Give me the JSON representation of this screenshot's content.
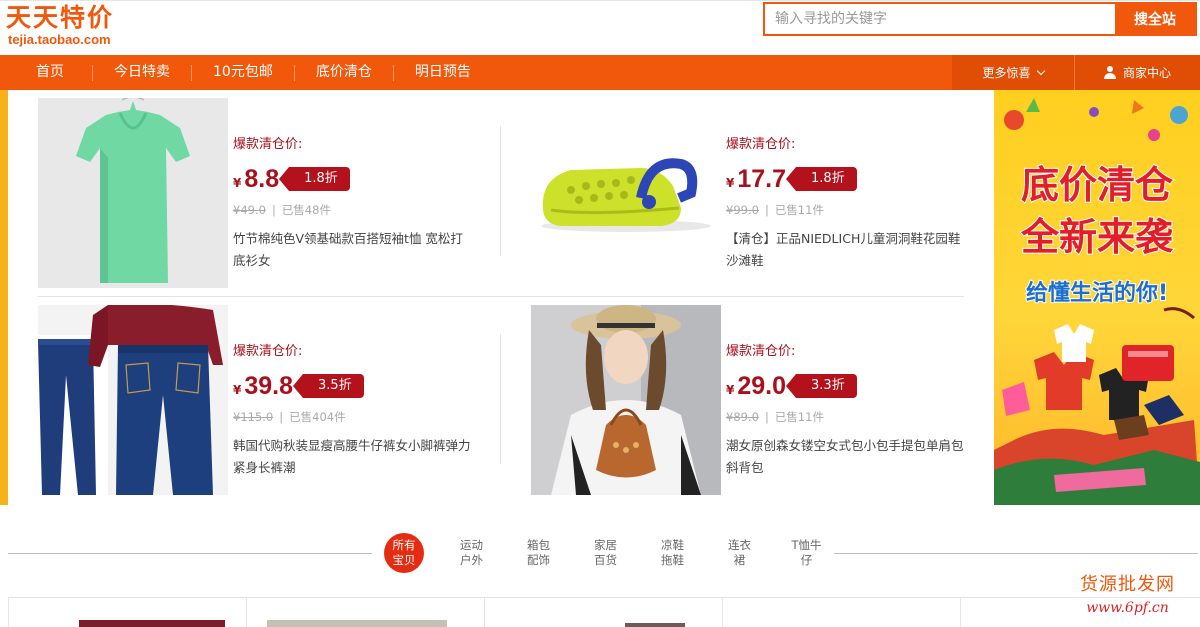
{
  "header": {
    "logo_title": "天天特价",
    "logo_url": "tejia.taobao.com",
    "search_placeholder": "输入寻找的关键字",
    "search_button": "搜全站"
  },
  "nav": {
    "items": [
      "首页",
      "今日特卖",
      "10元包邮",
      "底价清仓",
      "明日预告"
    ],
    "more": "更多惊喜",
    "merchant": "商家中心"
  },
  "products": [
    {
      "label": "爆款清仓价:",
      "currency": "¥",
      "price": "8.8",
      "discount": "1.8折",
      "original": "¥49.0",
      "sold": "已售48件",
      "title": "竹节棉纯色V领基础款百搭短袖t恤 宽松打底衫女"
    },
    {
      "label": "爆款清仓价:",
      "currency": "¥",
      "price": "17.7",
      "discount": "1.8折",
      "original": "¥99.0",
      "sold": "已售11件",
      "title": "【清仓】正品NIEDLICH儿童洞洞鞋花园鞋沙滩鞋"
    },
    {
      "label": "爆款清仓价:",
      "currency": "¥",
      "price": "39.8",
      "discount": "3.5折",
      "original": "¥115.0",
      "sold": "已售404件",
      "title": "韩国代购秋装显瘦高腰牛仔裤女小脚裤弹力紧身长裤潮"
    },
    {
      "label": "爆款清仓价:",
      "currency": "¥",
      "price": "29.0",
      "discount": "3.3折",
      "original": "¥89.0",
      "sold": "已售11件",
      "title": "潮女原创森女镂空女式包小包手提包单肩包斜背包"
    }
  ],
  "promo": {
    "line1": "底价清仓",
    "line2": "全新来袭",
    "line3": "给懂生活的你!"
  },
  "categories": [
    {
      "l1": "所有",
      "l2": "宝贝"
    },
    {
      "l1": "运动",
      "l2": "户外"
    },
    {
      "l1": "箱包",
      "l2": "配饰"
    },
    {
      "l1": "家居",
      "l2": "百货"
    },
    {
      "l1": "凉鞋",
      "l2": "拖鞋"
    },
    {
      "l1": "连衣",
      "l2": "裙"
    },
    {
      "l1": "T恤牛",
      "l2": "仔"
    }
  ],
  "watermark": {
    "line1": "货源批发网",
    "line2": "www.6pf.cn"
  },
  "colors": {
    "brand": "#f2580b",
    "price": "#a8111b",
    "discount_tag": "#b3111b",
    "active_category": "#e52b12"
  },
  "icons": [
    "chevron-down-icon",
    "user-icon"
  ]
}
